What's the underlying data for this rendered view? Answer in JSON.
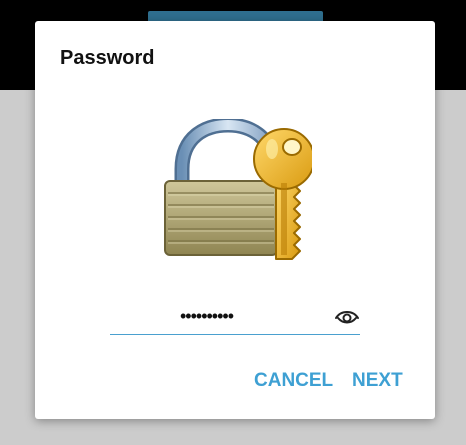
{
  "dialog": {
    "title": "Password",
    "password_field": {
      "value": "••••••••••",
      "visibility_icon": "eye-icon"
    },
    "actions": {
      "cancel_label": "CANCEL",
      "next_label": "NEXT"
    },
    "illustration_icon": "lock-with-key-icon"
  },
  "colors": {
    "accent": "#3ea0d3",
    "field_underline": "#4aa0cf",
    "backdrop": "#cccccc",
    "top_bar": "#000000"
  }
}
